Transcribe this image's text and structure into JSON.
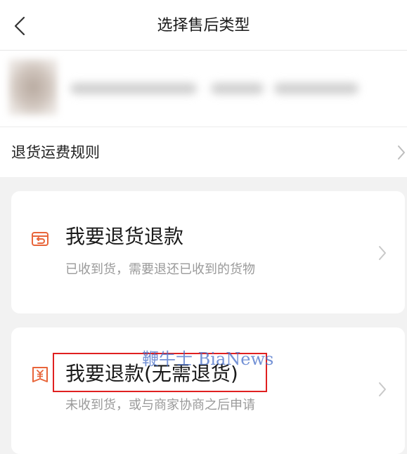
{
  "header": {
    "title": "选择售后类型",
    "back_icon": "chevron-left-icon"
  },
  "rule_row": {
    "label": "退货运费规则",
    "icon": "chevron-right-icon"
  },
  "options": [
    {
      "title": "我要退货退款",
      "subtitle": "已收到货，需要退还已收到的货物",
      "icon": "return-box-icon",
      "icon_color": "#e8653a"
    },
    {
      "title": "我要退款(无需退货)",
      "subtitle": "未收到货，或与商家协商之后申请",
      "icon": "yuan-tag-icon",
      "icon_color": "#e8653a"
    }
  ],
  "watermark": "鞭牛士 BiaNews",
  "colors": {
    "accent": "#e8653a",
    "highlight": "#e02020",
    "background": "#f2f2f2"
  }
}
